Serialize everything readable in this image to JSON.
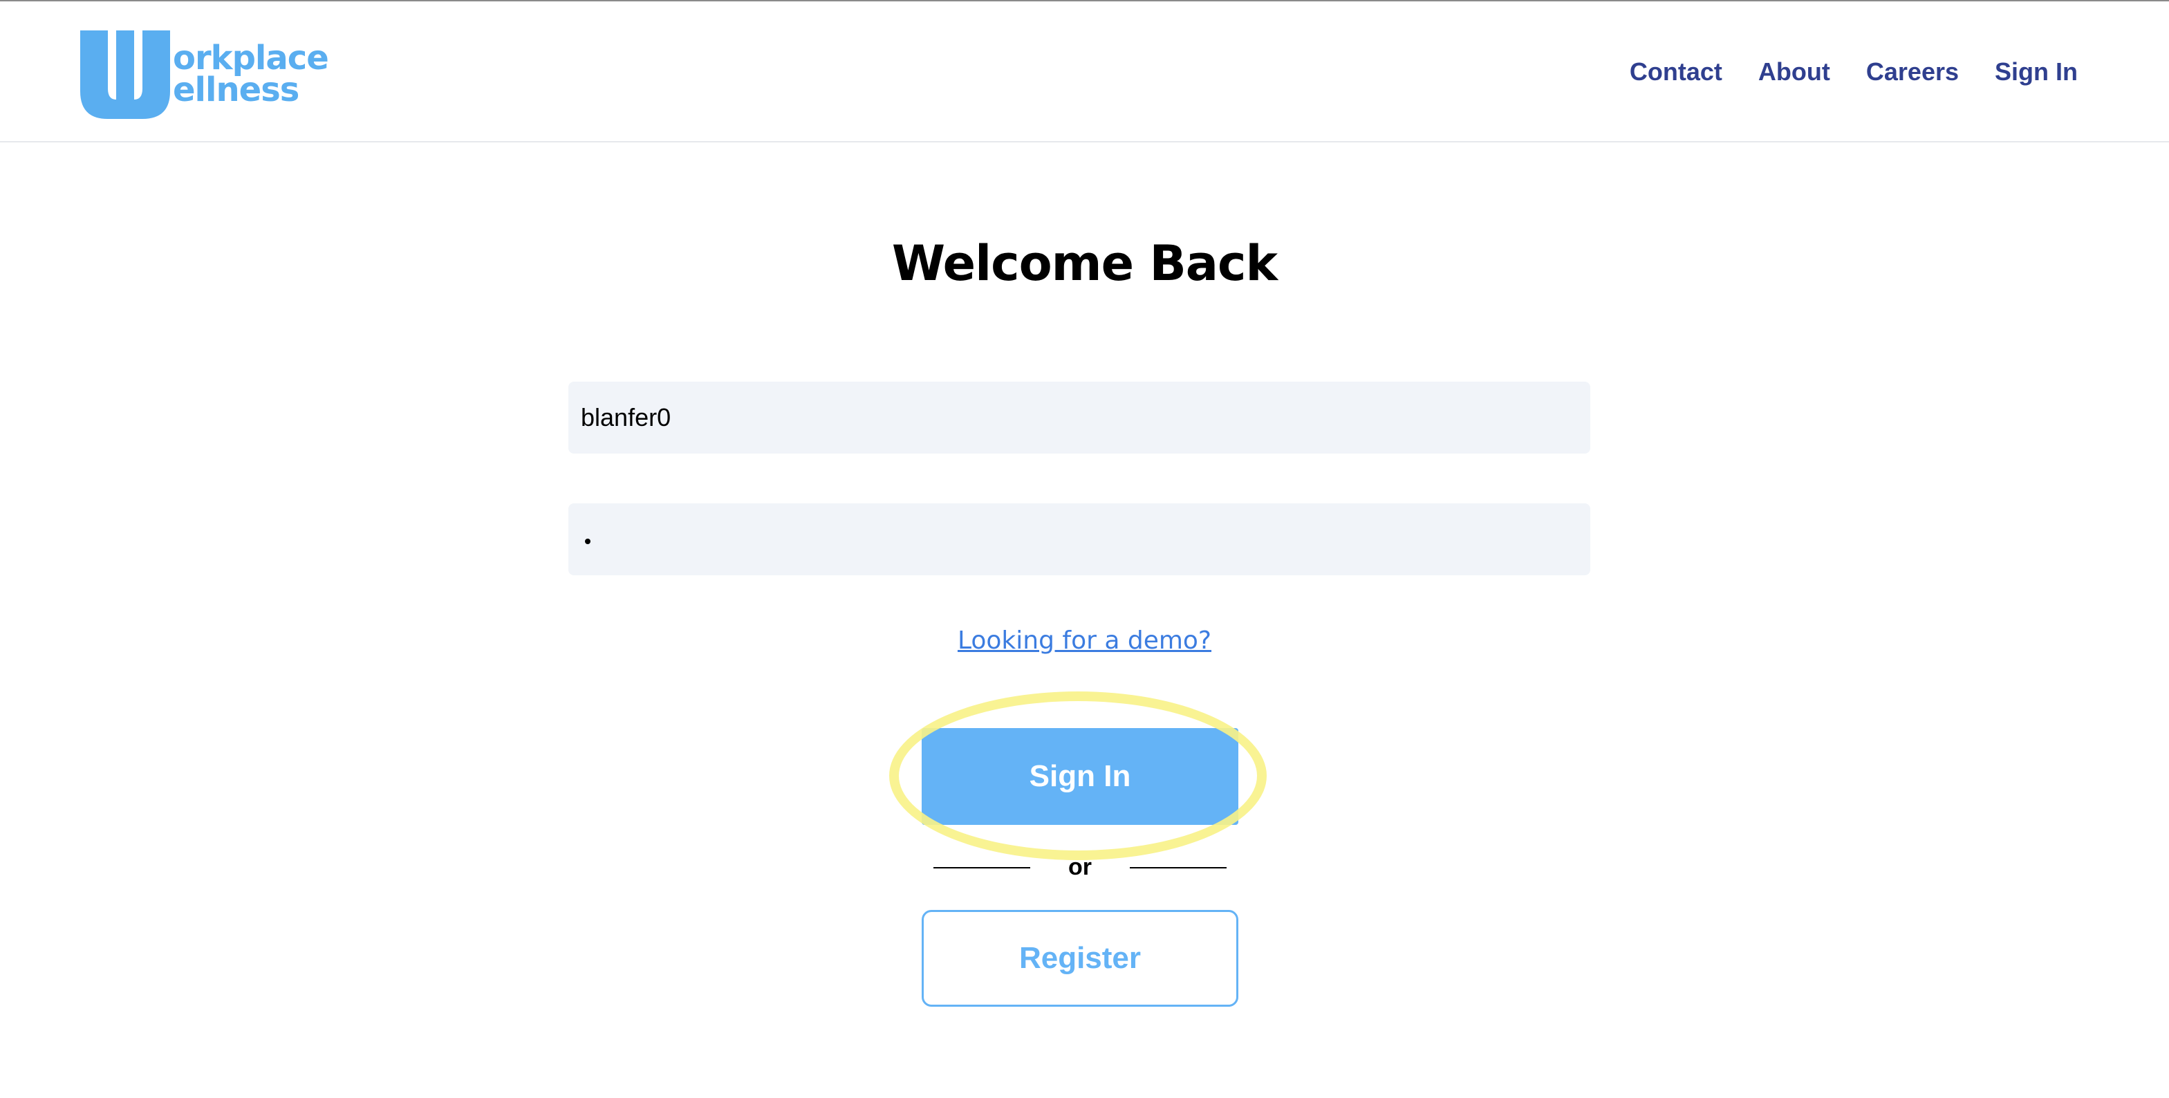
{
  "brand": {
    "logo_letter": "W",
    "logo_line1": "orkplace",
    "logo_line2": "ellness",
    "color": "#5aaef0"
  },
  "nav": {
    "items": [
      {
        "label": "Contact"
      },
      {
        "label": "About"
      },
      {
        "label": "Careers"
      },
      {
        "label": "Sign In"
      }
    ],
    "color": "#2f3f8f"
  },
  "main": {
    "title": "Welcome Back",
    "username_value": "blanfer0",
    "password_mask": "•",
    "demo_link": "Looking for a demo?",
    "signin_label": "Sign In",
    "or_label": "or",
    "register_label": "Register",
    "accent": "#64b3f6",
    "field_bg": "#f1f4f9",
    "highlight_color": "#f8f287"
  }
}
